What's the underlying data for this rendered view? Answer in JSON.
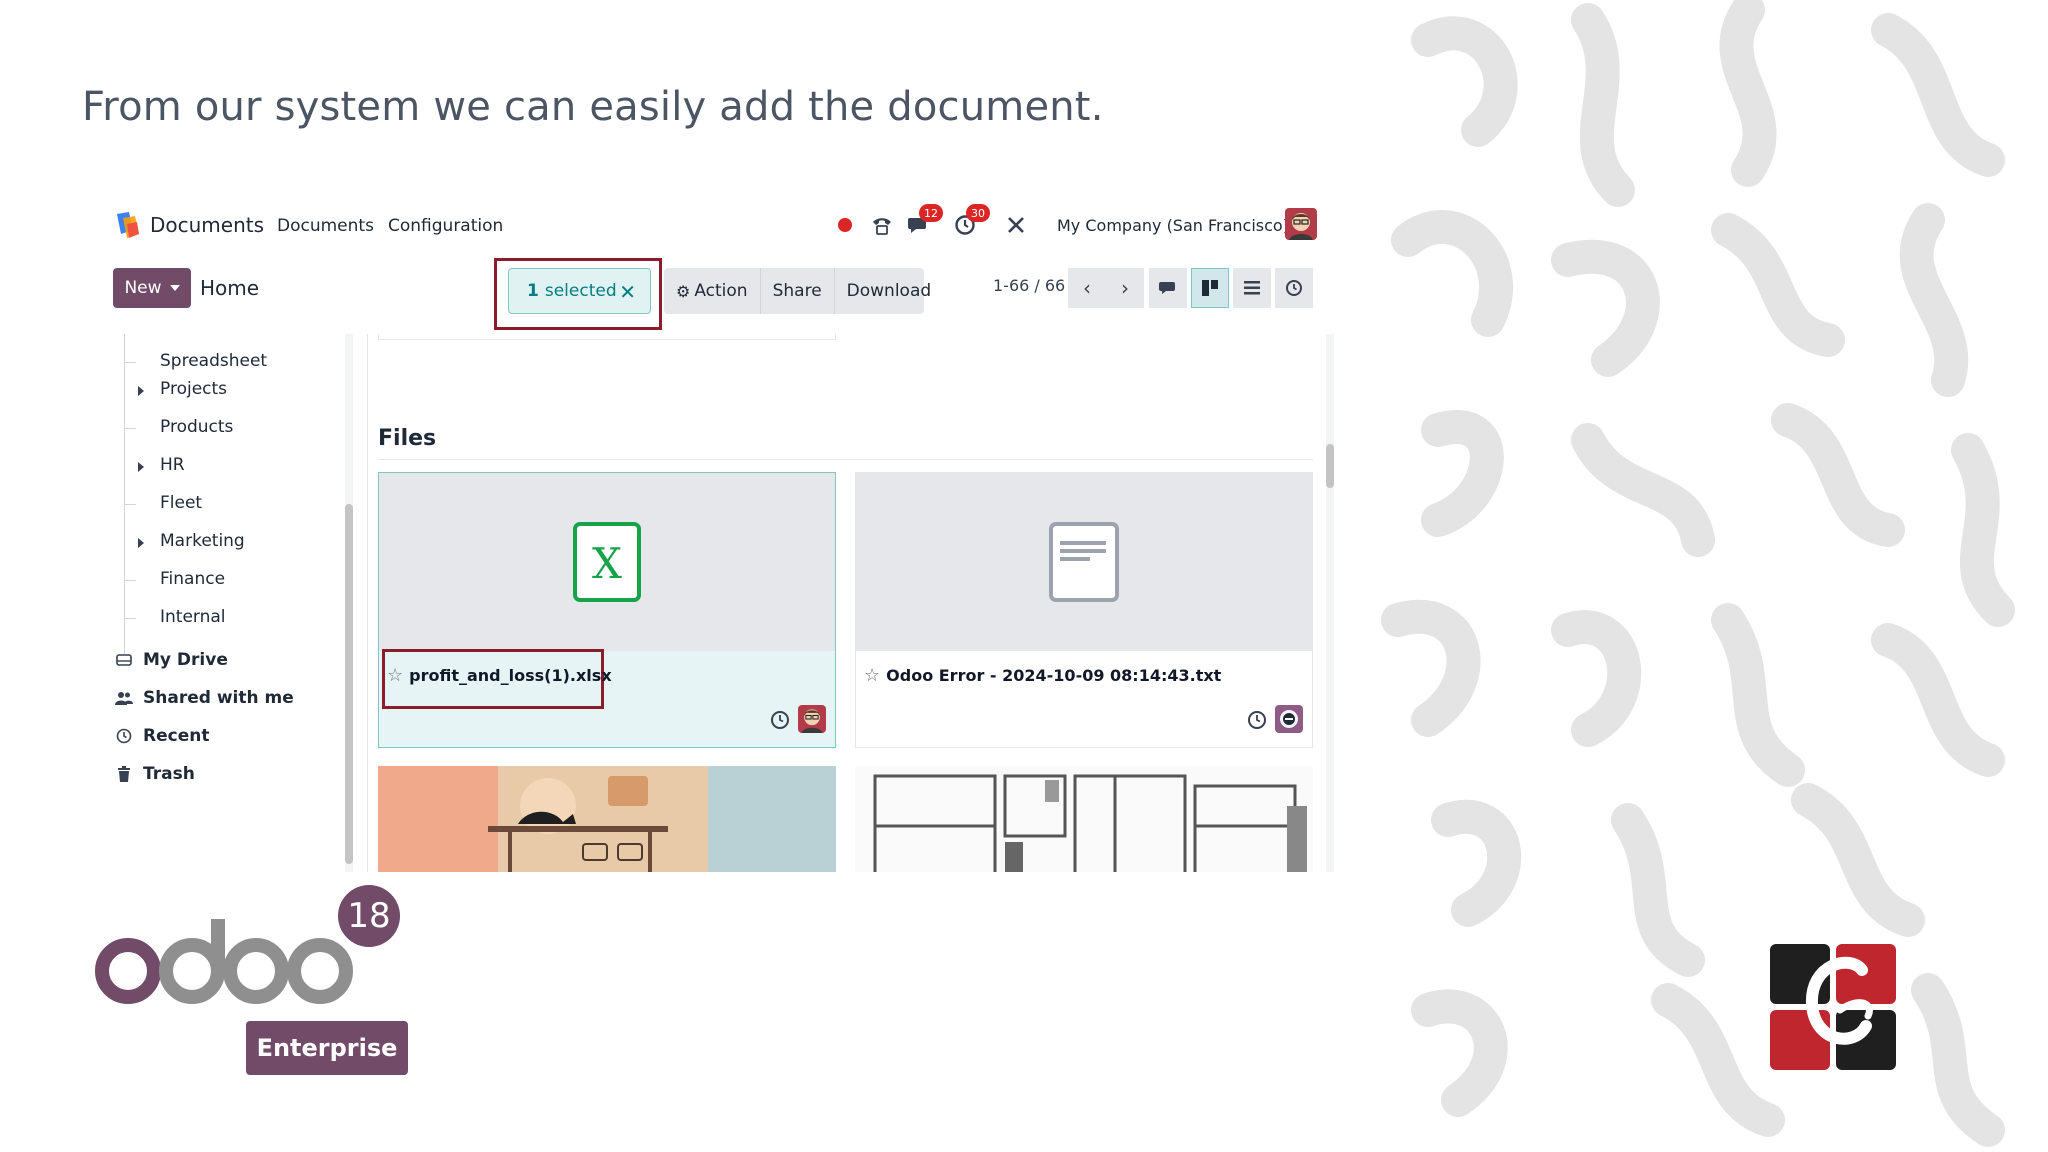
{
  "slide": {
    "title": "From our system we can easily add the document."
  },
  "navbar": {
    "app_name": "Documents",
    "menu": [
      "Documents",
      "Configuration"
    ],
    "messages_badge": "12",
    "activities_badge": "30",
    "company": "My Company (San Francisco)"
  },
  "control": {
    "new_label": "New",
    "breadcrumb": "Home",
    "selection_count": "1",
    "selection_label": "selected",
    "actions": [
      "Action",
      "Share",
      "Download"
    ],
    "pager": "1-66 / 66"
  },
  "sidebar": {
    "tree": [
      {
        "label": "Spreadsheet",
        "expandable": false
      },
      {
        "label": "Projects",
        "expandable": true
      },
      {
        "label": "Products",
        "expandable": false
      },
      {
        "label": "HR",
        "expandable": true
      },
      {
        "label": "Fleet",
        "expandable": false
      },
      {
        "label": "Marketing",
        "expandable": true
      },
      {
        "label": "Finance",
        "expandable": false
      },
      {
        "label": "Internal",
        "expandable": false
      }
    ],
    "sections": [
      {
        "label": "My Drive",
        "icon": "hdd-icon"
      },
      {
        "label": "Shared with me",
        "icon": "users-icon"
      },
      {
        "label": "Recent",
        "icon": "clock-icon"
      },
      {
        "label": "Trash",
        "icon": "trash-icon"
      }
    ]
  },
  "content": {
    "section_title": "Files",
    "files": [
      {
        "name": "profit_and_loss(1).xlsx",
        "type": "spreadsheet",
        "selected": true
      },
      {
        "name": "Odoo Error - 2024-10-09 08:14:43.txt",
        "type": "text",
        "selected": false
      }
    ]
  },
  "branding": {
    "odoo_version": "18",
    "edition": "Enterprise",
    "brand_color": "#714b67"
  }
}
